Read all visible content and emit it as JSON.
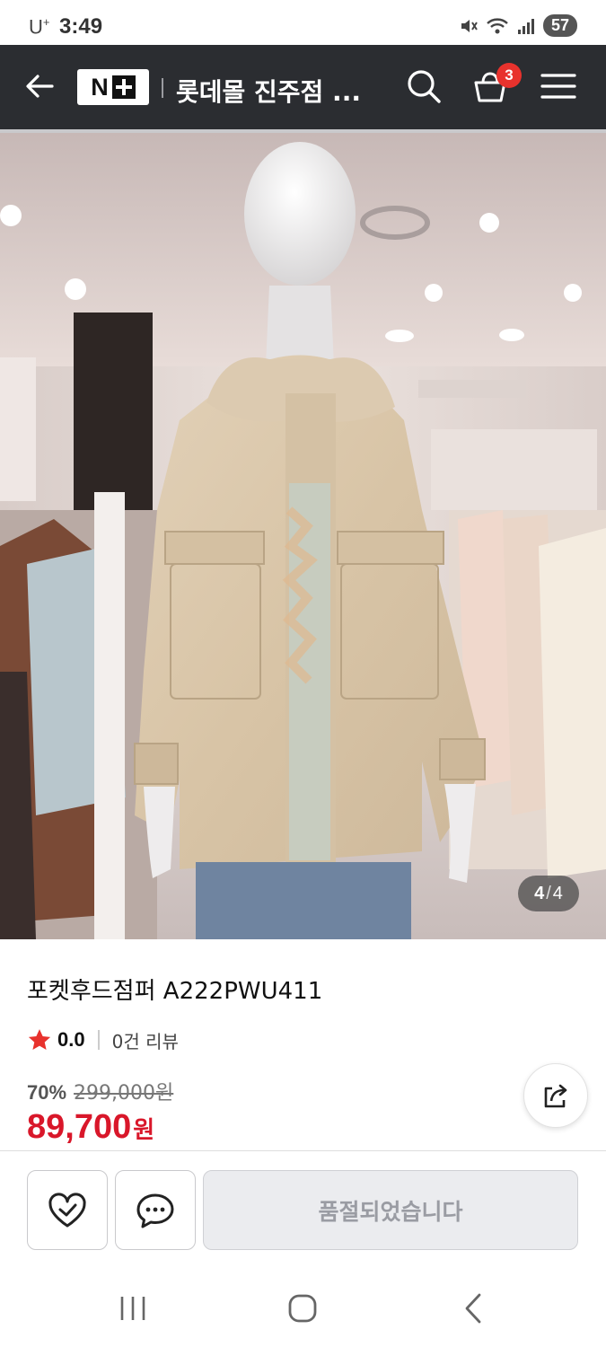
{
  "status_bar": {
    "carrier": "U",
    "carrier_sup": "+",
    "time": "3:49",
    "battery": "57"
  },
  "header": {
    "logo_letter": "N",
    "store_title": "롯데몰 진주점 ...",
    "cart_count": "3",
    "icons": [
      "back-arrow-icon",
      "search-icon",
      "cart-icon",
      "menu-icon"
    ]
  },
  "gallery": {
    "current": "4",
    "separator": "/",
    "total": "4"
  },
  "product": {
    "name": "포켓후드점퍼 A222PWU411",
    "rating": "0.0",
    "review_count": "0건 리뷰",
    "discount": "70%",
    "original_price": "299,000원",
    "sale_price": "89,700",
    "sale_unit": "원"
  },
  "actions": {
    "soldout_label": "품절되었습니다"
  },
  "colors": {
    "header_bg": "#2b2d31",
    "accent_red": "#d9172a",
    "badge_red": "#e8322d",
    "star": "#e8322d"
  }
}
